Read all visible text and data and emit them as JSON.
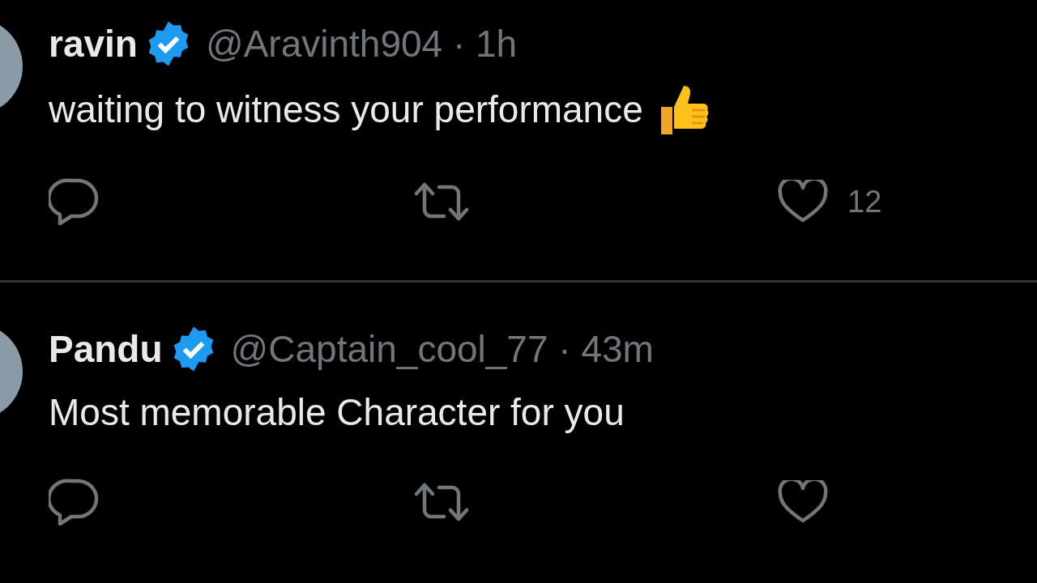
{
  "tweets": [
    {
      "author": "ravin",
      "verified": true,
      "handle": "@Aravinth904",
      "separator": "·",
      "time": "1h",
      "text": "waiting to witness your performance",
      "thumbs_up": true,
      "like_count": "12"
    },
    {
      "author": "Pandu",
      "verified": true,
      "handle": "@Captain_cool_77",
      "separator": "·",
      "time": "43m",
      "text": "Most memorable Character for you",
      "thumbs_up": false
    }
  ]
}
